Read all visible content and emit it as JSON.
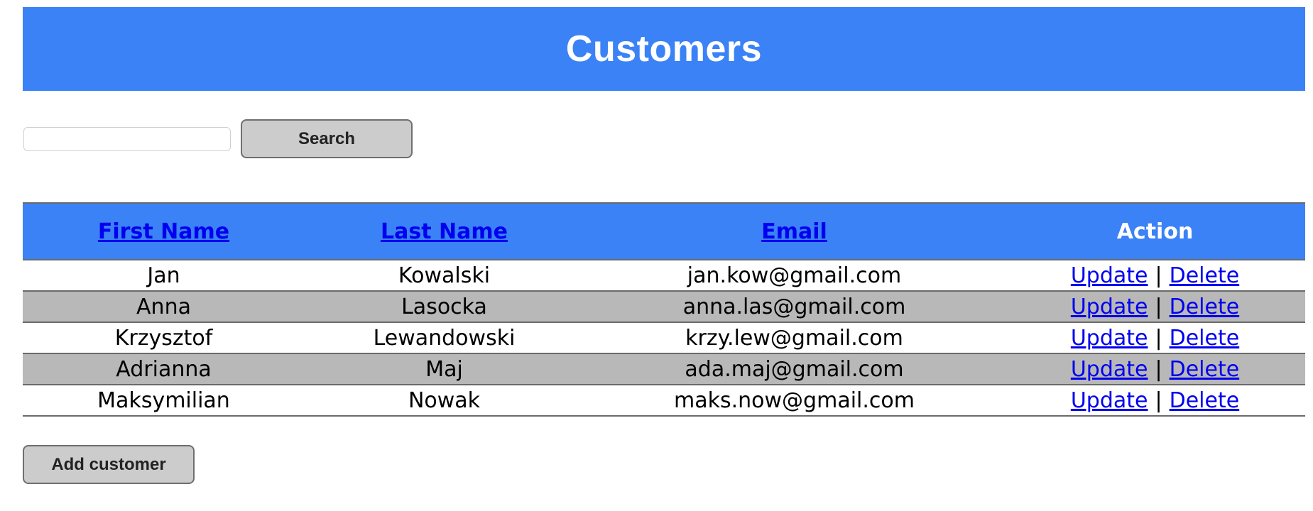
{
  "header": {
    "title": "Customers"
  },
  "search": {
    "value": "",
    "placeholder": "",
    "button_label": "Search"
  },
  "table": {
    "columns": {
      "first_name": "First Name",
      "last_name": "Last Name",
      "email": "Email",
      "action": "Action"
    },
    "rows": [
      {
        "first_name": "Jan",
        "last_name": "Kowalski",
        "email": "jan.kow@gmail.com",
        "update_label": "Update",
        "separator": "|",
        "delete_label": "Delete"
      },
      {
        "first_name": "Anna",
        "last_name": "Lasocka",
        "email": "anna.las@gmail.com",
        "update_label": "Update",
        "separator": "|",
        "delete_label": "Delete"
      },
      {
        "first_name": "Krzysztof",
        "last_name": "Lewandowski",
        "email": "krzy.lew@gmail.com",
        "update_label": "Update",
        "separator": "|",
        "delete_label": "Delete"
      },
      {
        "first_name": "Adrianna",
        "last_name": "Maj",
        "email": "ada.maj@gmail.com",
        "update_label": "Update",
        "separator": "|",
        "delete_label": "Delete"
      },
      {
        "first_name": "Maksymilian",
        "last_name": "Nowak",
        "email": "maks.now@gmail.com",
        "update_label": "Update",
        "separator": "|",
        "delete_label": "Delete"
      }
    ]
  },
  "footer": {
    "add_label": "Add customer"
  },
  "colors": {
    "header_bg": "#3b82f6",
    "link": "#0000ee",
    "stripe": "#b8b8b8",
    "button_bg": "#cccccc"
  }
}
